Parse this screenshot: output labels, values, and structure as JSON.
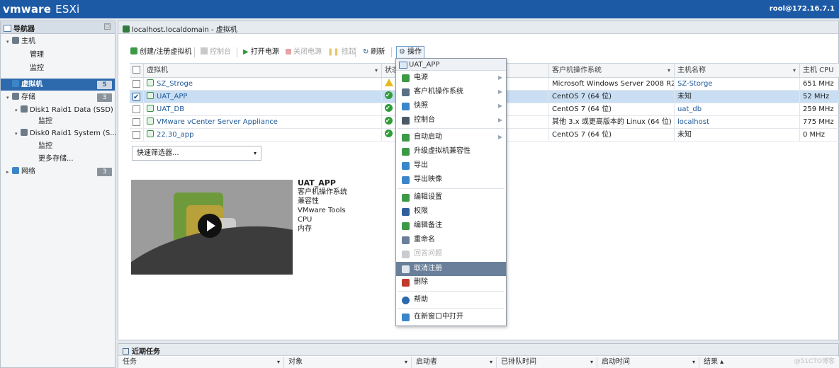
{
  "topbar": {
    "brand": "vmware",
    "product": "ESXi",
    "user": "rool@172.16.7.1"
  },
  "navigator": {
    "title": "导航器",
    "items": [
      {
        "label": "主机",
        "level": 0,
        "twisty": "▾"
      },
      {
        "label": "管理",
        "level": 1
      },
      {
        "label": "监控",
        "level": 1
      },
      {
        "label": "虚拟机",
        "level": 0,
        "badge": "5",
        "selected": true
      },
      {
        "label": "存储",
        "level": 0,
        "twisty": "▾",
        "badge": "3"
      },
      {
        "label": "Disk1 Raid1 Data (SSD)",
        "level": 1,
        "twisty": "▾"
      },
      {
        "label": "监控",
        "level": 2
      },
      {
        "label": "Disk0 Raid1 System (S...",
        "level": 1,
        "twisty": "▾"
      },
      {
        "label": "监控",
        "level": 2
      },
      {
        "label": "更多存储...",
        "level": 2
      },
      {
        "label": "网络",
        "level": 0,
        "twisty": "▸",
        "badge": "3"
      }
    ]
  },
  "main": {
    "title": "localhost.localdomain - 虚拟机",
    "toolbar": {
      "create": "创建/注册虚拟机",
      "console": "控制台",
      "power_on": "打开电源",
      "power_off": "关闭电源",
      "suspend": "挂起",
      "refresh": "刷新",
      "actions": "操作"
    },
    "table": {
      "headers": {
        "vm": "虚拟机",
        "status": "状态",
        "guest_os": "客户机操作系统",
        "host_name": "主机名称",
        "host_cpu": "主机 CPU"
      },
      "rows": [
        {
          "name": "SZ_Stroge",
          "status": "warn",
          "checked": false,
          "selected": false,
          "os": "Microsoft Windows Server 2008 R2 (64 位)",
          "host": "SZ-Storge",
          "host_link": true,
          "cpu": "651 MHz"
        },
        {
          "name": "UAT_APP",
          "status": "ok",
          "checked": true,
          "selected": true,
          "os": "CentOS 7 (64 位)",
          "host": "未知",
          "host_link": false,
          "cpu": "52 MHz"
        },
        {
          "name": "UAT_DB",
          "status": "ok",
          "checked": false,
          "selected": false,
          "os": "CentOS 7 (64 位)",
          "host": "uat_db",
          "host_link": true,
          "cpu": "259 MHz"
        },
        {
          "name": "VMware vCenter Server Appliance",
          "status": "ok",
          "checked": false,
          "selected": false,
          "os": "其他 3.x 或更高版本的 Linux (64 位)",
          "host": "localhost",
          "host_link": true,
          "cpu": "775 MHz"
        },
        {
          "name": "22.30_app",
          "status": "ok",
          "checked": false,
          "selected": false,
          "os": "CentOS 7 (64 位)",
          "host": "未知",
          "host_link": false,
          "cpu": "0 MHz"
        }
      ]
    },
    "filter_placeholder": "快速筛选器...",
    "details": {
      "name": "UAT_APP",
      "fields": [
        "客户机操作系统",
        "兼容性",
        "VMware Tools",
        "CPU",
        "内存"
      ]
    }
  },
  "context_menu": {
    "title": "UAT_APP",
    "items": [
      {
        "label": "电源",
        "submenu": true,
        "color": "#3c9a47"
      },
      {
        "label": "客户机操作系统",
        "submenu": true,
        "color": "#5b6f86"
      },
      {
        "label": "快照",
        "submenu": true,
        "color": "#3b86c9"
      },
      {
        "label": "控制台",
        "submenu": true,
        "color": "#4c5a68"
      },
      {
        "label": "自动启动",
        "submenu": true,
        "color": "#3c9a47",
        "sep_before": true
      },
      {
        "label": "升级虚拟机兼容性",
        "color": "#3c9a47"
      },
      {
        "label": "导出",
        "color": "#3b86c9"
      },
      {
        "label": "导出映像",
        "color": "#3b86c9"
      },
      {
        "label": "编辑设置",
        "color": "#3c9a47",
        "sep_before": true
      },
      {
        "label": "权限",
        "color": "#2f5e9a"
      },
      {
        "label": "编辑备注",
        "color": "#3c9a47"
      },
      {
        "label": "重命名",
        "color": "#6a7f99"
      },
      {
        "label": "回答问题",
        "disabled": true,
        "color": "#c8ccd1"
      },
      {
        "label": "取消注册",
        "highlighted": true,
        "color": "#dfe6ee"
      },
      {
        "label": "删除",
        "color": "#c0392b"
      },
      {
        "label": "帮助",
        "color": "#2d6aad",
        "sep_before": true
      },
      {
        "label": "在新窗口中打开",
        "color": "#3b86c9",
        "sep_before": true
      }
    ]
  },
  "tasks": {
    "title": "近期任务",
    "columns": [
      {
        "label": "任务",
        "sort": "▾"
      },
      {
        "label": "对象",
        "sort": "▾"
      },
      {
        "label": "启动者",
        "sort": "▾"
      },
      {
        "label": "已排队时间",
        "sort": "▾"
      },
      {
        "label": "启动时间",
        "sort": "▾"
      },
      {
        "label": "结果 ▴",
        "sort": ""
      }
    ]
  },
  "watermark": "@51CTO博客"
}
